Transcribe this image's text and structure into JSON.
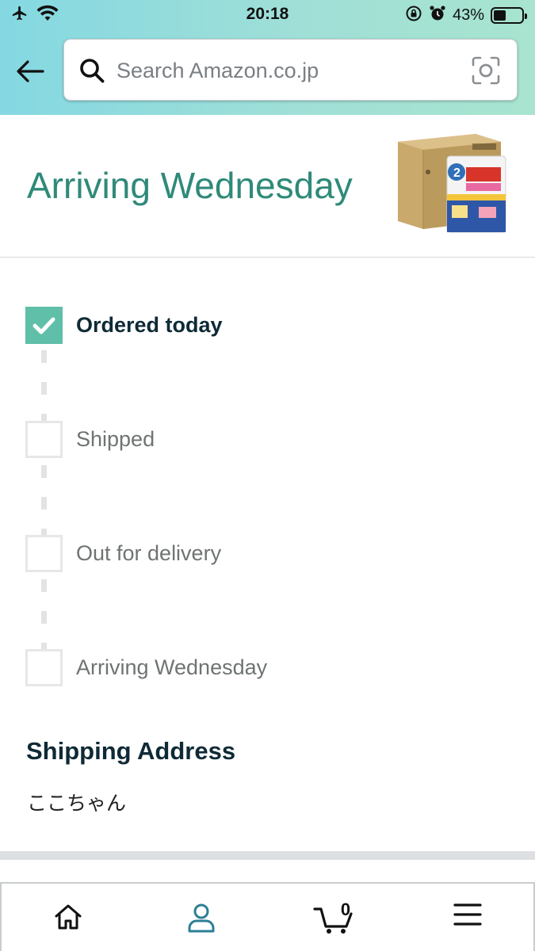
{
  "status_bar": {
    "time": "20:18",
    "battery_percent_label": "43%",
    "battery_level": 0.43
  },
  "search": {
    "placeholder": "Search Amazon.co.jp"
  },
  "delivery": {
    "title": "Arriving Wednesday"
  },
  "tracking": {
    "steps": [
      {
        "label": "Ordered today",
        "done": true
      },
      {
        "label": "Shipped",
        "done": false
      },
      {
        "label": "Out for delivery",
        "done": false
      },
      {
        "label": "Arriving Wednesday",
        "done": false
      }
    ]
  },
  "shipping": {
    "title": "Shipping Address",
    "name": "ここちゃん"
  },
  "nav": {
    "cart_count": "0",
    "items": [
      "home-icon",
      "account-icon",
      "cart-icon",
      "menu-icon"
    ]
  },
  "colors": {
    "header_gradient_start": "#84d8e2",
    "header_gradient_end": "#a8e4cf",
    "delivery_title": "#2f8a78",
    "check_done": "#5fbfa9",
    "nav_active": "#2c7f95"
  }
}
